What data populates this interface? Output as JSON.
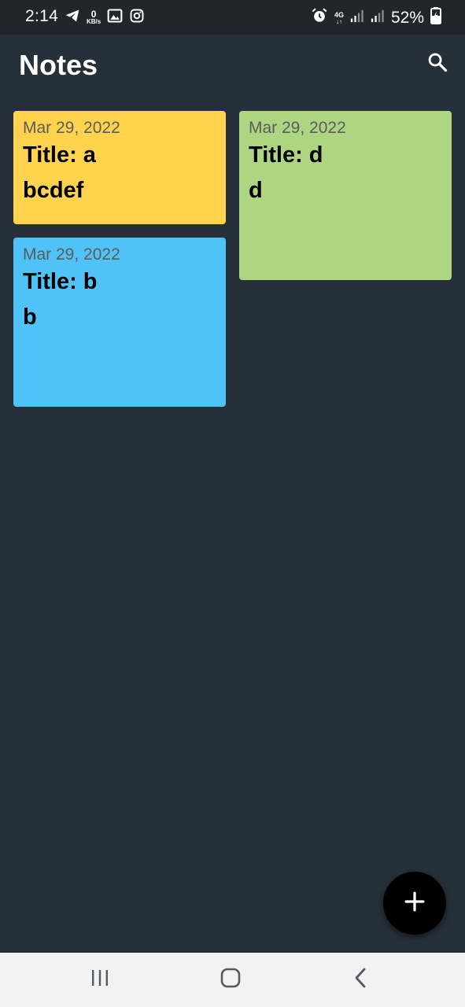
{
  "status_bar": {
    "time": "2:14",
    "net_speed_value": "0",
    "net_speed_unit": "KB/s",
    "network_type": "4G",
    "battery": "52%",
    "left_icons": [
      "telegram-icon",
      "kbs-icon",
      "gallery-icon",
      "instagram-icon"
    ],
    "right_icons": [
      "alarm-icon",
      "4g-icon",
      "signal-icon",
      "signal-icon",
      "battery-icon"
    ]
  },
  "app_bar": {
    "title": "Notes",
    "search_icon": "search-icon"
  },
  "notes": [
    {
      "date": "Mar 29, 2022",
      "title": "Title: a",
      "body": "bcdef",
      "color": "#ffd34e"
    },
    {
      "date": "Mar 29, 2022",
      "title": "Title: d",
      "body": "d",
      "color": "#aed581"
    },
    {
      "date": "Mar 29, 2022",
      "title": "Title: b",
      "body": "b",
      "color": "#4fc3f7"
    }
  ],
  "fab": {
    "icon": "plus-icon"
  },
  "nav_bar": {
    "items": [
      "recent-apps-icon",
      "home-icon",
      "back-icon"
    ]
  },
  "colors": {
    "background": "#263038",
    "status_bar": "#1f272d",
    "nav_bar": "#f2f2f2",
    "fab": "#000000"
  }
}
